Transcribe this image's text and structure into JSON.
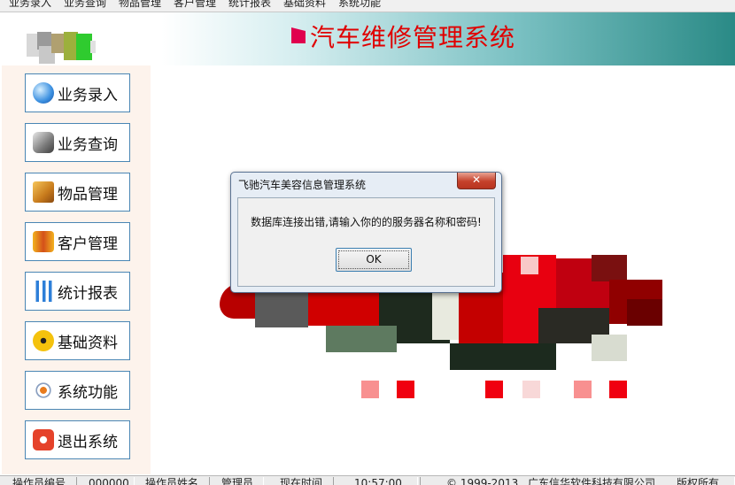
{
  "menu": {
    "items": [
      "业务录入",
      "业务查询",
      "物品管理",
      "客户管理",
      "统计报表",
      "基础资料",
      "系统功能"
    ]
  },
  "header": {
    "title": "汽车维修管理系统"
  },
  "sidebar": {
    "items": [
      {
        "label": "业务录入",
        "icon": "globe-icon"
      },
      {
        "label": "业务查询",
        "icon": "search-icon"
      },
      {
        "label": "物品管理",
        "icon": "box-icon"
      },
      {
        "label": "客户管理",
        "icon": "users-icon"
      },
      {
        "label": "统计报表",
        "icon": "chart-icon"
      },
      {
        "label": "基础资料",
        "icon": "radiation-icon"
      },
      {
        "label": "系统功能",
        "icon": "atom-icon"
      },
      {
        "label": "退出系统",
        "icon": "power-icon"
      }
    ]
  },
  "dialog": {
    "title": "飞驰汽车美容信息管理系统",
    "close": "✕",
    "message": "数据库连接出错,请输入你的的服务器名称和密码!",
    "ok_label": "OK"
  },
  "statusbar": {
    "operator_id_label": "操作员编号",
    "operator_id": "000000",
    "operator_name_label": "操作员姓名",
    "operator_name": "管理员",
    "time_label": "现在时间",
    "time": "10:57:00",
    "copyright": "© 1999-2013",
    "company": "广东信华软件科技有限公司",
    "rights": "版权所有"
  },
  "colors": {
    "title": "#e00000",
    "nav_border": "#4a86b4",
    "sidebar_bg": "#fdf3ec",
    "banner_end": "#2a8a86"
  }
}
